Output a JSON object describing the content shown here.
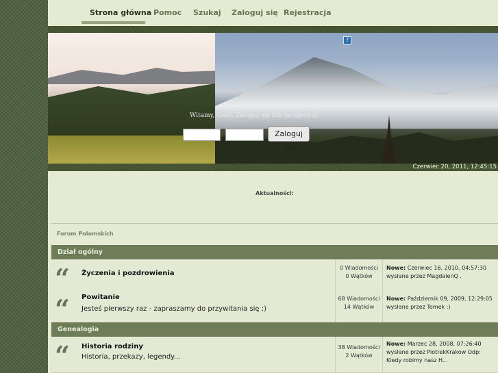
{
  "nav": {
    "items": [
      "Strona główna",
      "Pomoc",
      "Szukaj",
      "Zaloguj się",
      "Rejestracja"
    ]
  },
  "banner": {
    "welcome": "Witamy, Gość. Zaloguj się lub zarejestruj.",
    "login_button": "Zaloguj się",
    "date": "Czerwiec 20, 2011, 12:45:15"
  },
  "news": {
    "title": "Aktualności:"
  },
  "breadcrumb": "Forum Polomskich",
  "categories": [
    {
      "title": "Dział ogólny",
      "boards": [
        {
          "name": "Życzenia i pozdrowienia",
          "desc": "",
          "posts": "0 Wiadomości",
          "topics": "0 Wątków",
          "last_label": "Nowe:",
          "last_date": "Czerwiec 16, 2010, 04:57:30",
          "last_line2": "wysłane przez MagdalenQ .",
          "last_line3": ""
        },
        {
          "name": "Powitanie",
          "desc": "Jesteś pierwszy raz - zapraszamy do przywitania się ;)",
          "posts": "68 Wiadomości",
          "topics": "14 Wątków",
          "last_label": "Nowe:",
          "last_date": "Październik 09, 2009, 12:29:05",
          "last_line2": "wysłane przez Tomek :)",
          "last_line3": ""
        }
      ]
    },
    {
      "title": "Genealogia",
      "boards": [
        {
          "name": "Historia rodziny",
          "desc": "Historia, przekazy, legendy...",
          "posts": "38 Wiadomości",
          "topics": "2 Wątków",
          "last_label": "Nowe:",
          "last_date": "Marzec 28, 2008, 07:26:40",
          "last_line2": "wysłane przez PiotrekKrakow Odp:",
          "last_line3": "Kiedy robimy nasz H..."
        }
      ]
    }
  ],
  "icons": {
    "board": "quote-icon",
    "help": "question-icon"
  }
}
